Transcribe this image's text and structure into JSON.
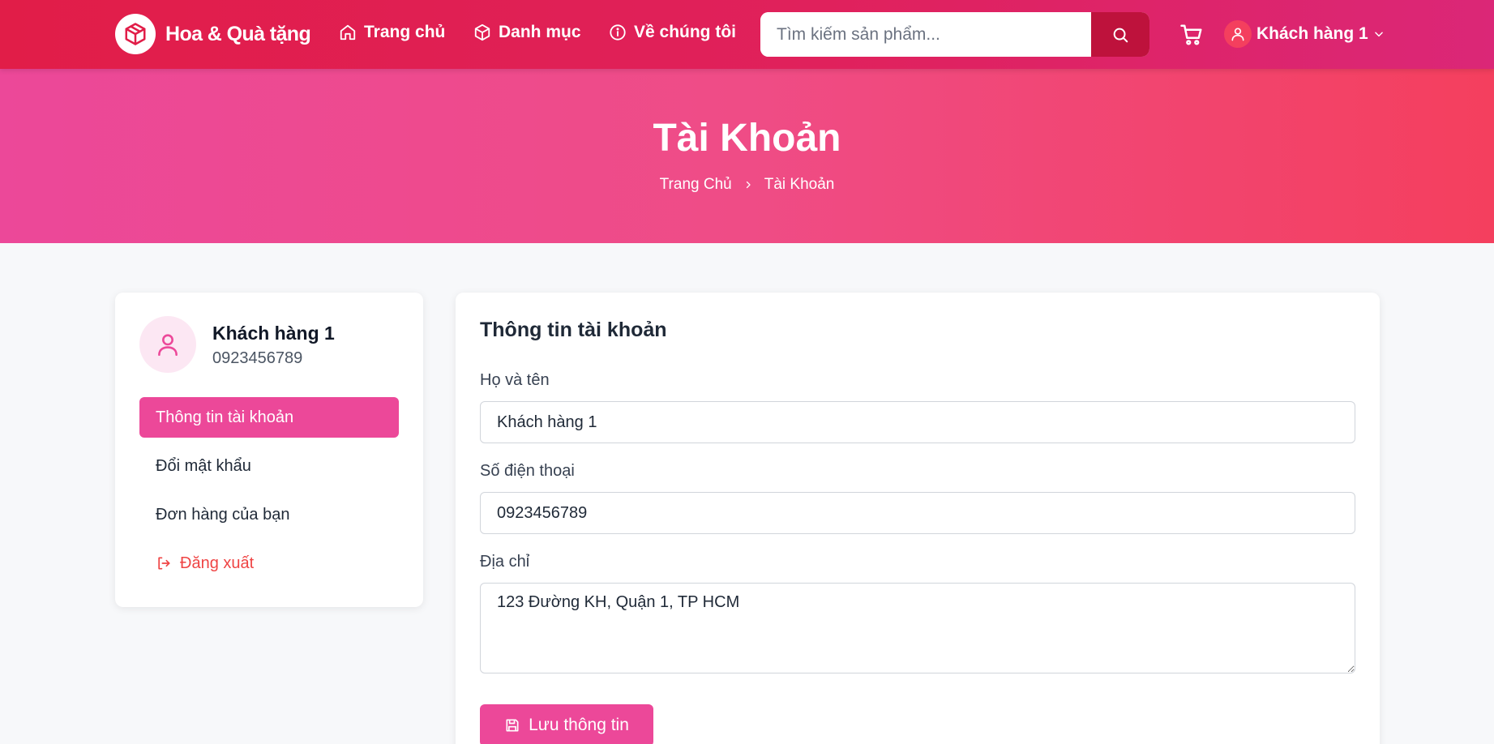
{
  "header": {
    "brand": "Hoa & Quà tặng",
    "nav": [
      {
        "label": "Trang chủ",
        "icon": "home-icon"
      },
      {
        "label": "Danh mục",
        "icon": "box-icon"
      },
      {
        "label": "Về chúng tôi",
        "icon": "info-icon"
      }
    ],
    "search_placeholder": "Tìm kiếm sản phẩm...",
    "user_label": "Khách hàng 1"
  },
  "hero": {
    "title": "Tài Khoản",
    "breadcrumb": [
      "Trang Chủ",
      "Tài Khoản"
    ]
  },
  "sidebar": {
    "name": "Khách hàng 1",
    "phone": "0923456789",
    "menu": [
      {
        "label": "Thông tin tài khoản",
        "active": true
      },
      {
        "label": "Đổi mật khẩu",
        "active": false
      },
      {
        "label": "Đơn hàng của bạn",
        "active": false
      },
      {
        "label": "Đăng xuất",
        "active": false
      }
    ]
  },
  "form": {
    "title": "Thông tin tài khoản",
    "name_label": "Họ và tên",
    "name_value": "Khách hàng 1",
    "phone_label": "Số điện thoại",
    "phone_value": "0923456789",
    "address_label": "Địa chỉ",
    "address_value": "123 Đường KH, Quận 1, TP HCM",
    "save_label": "Lưu thông tin"
  },
  "colors": {
    "brand": "#e11d48",
    "accent_pink": "#ec4899",
    "search_button": "#be123c",
    "logout": "#ef4444"
  }
}
